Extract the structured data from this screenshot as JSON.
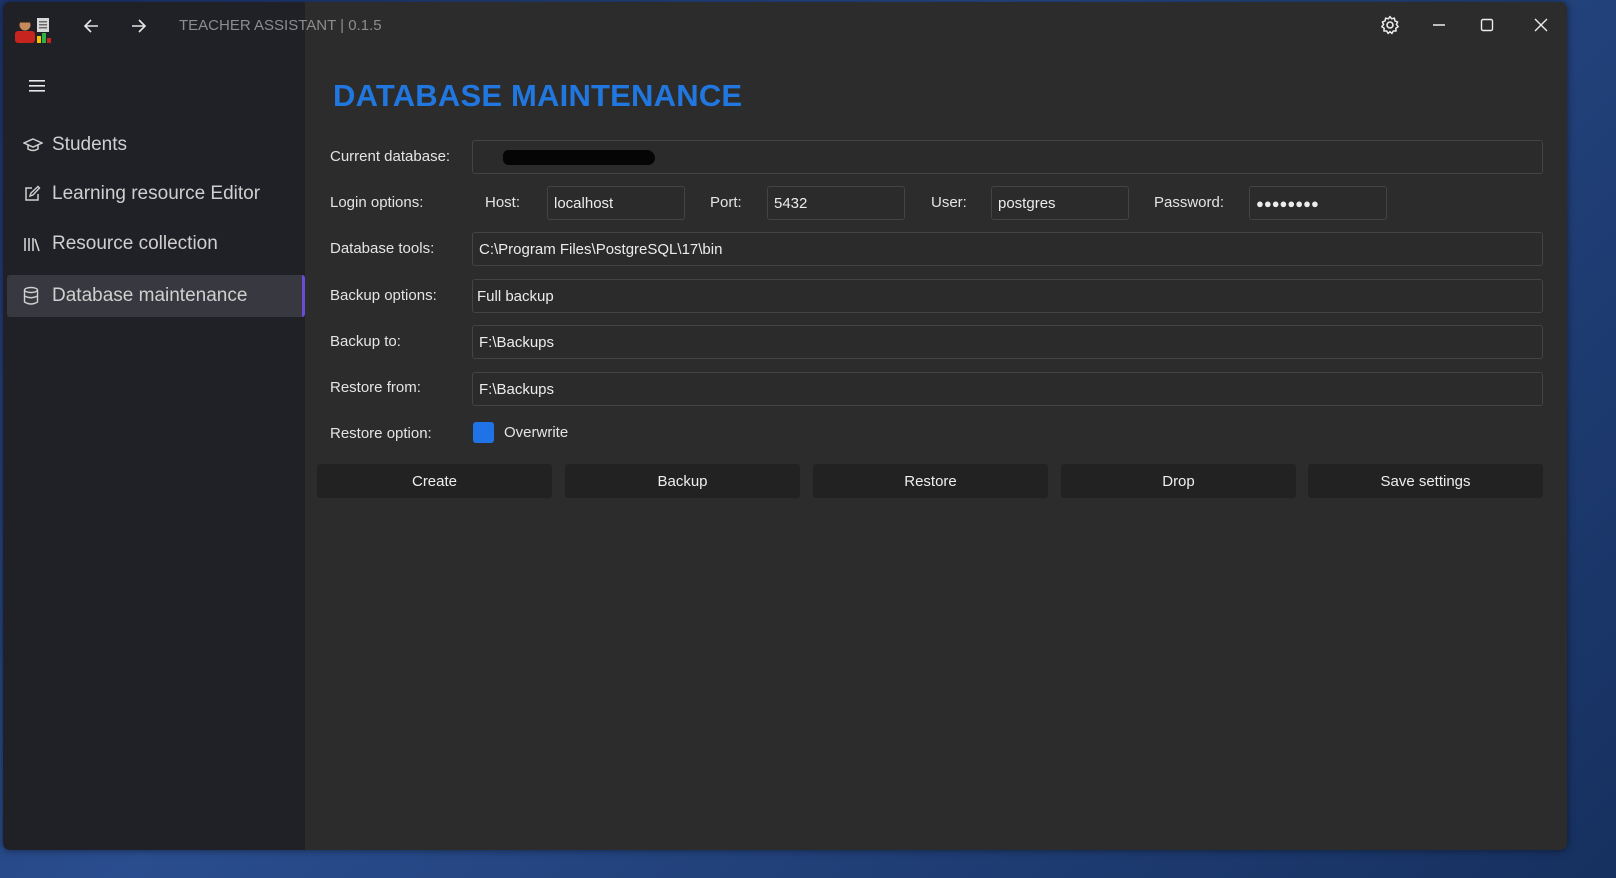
{
  "app": {
    "title": "TEACHER ASSISTANT | 0.1.5",
    "logo_icon": "teacher-app-logo",
    "accent_color": "#2177e0"
  },
  "sidebar": {
    "items": [
      {
        "label": "Students",
        "icon": "graduation-cap-icon"
      },
      {
        "label": "Learning resource Editor",
        "icon": "edit-icon"
      },
      {
        "label": "Resource collection",
        "icon": "library-icon"
      },
      {
        "label": "Database maintenance",
        "icon": "database-icon",
        "active": true
      }
    ]
  },
  "main": {
    "title": "DATABASE MAINTENANCE",
    "current_database": {
      "label": "Current database:",
      "value": ""
    },
    "login": {
      "label": "Login options:",
      "host_label": "Host:",
      "host_value": "localhost",
      "port_label": "Port:",
      "port_value": "5432",
      "user_label": "User:",
      "user_value": "postgres",
      "password_label": "Password:",
      "password_value": "●●●●●●●●"
    },
    "tools": {
      "label": "Database tools:",
      "value": "C:\\Program Files\\PostgreSQL\\17\\bin"
    },
    "backup_options": {
      "label": "Backup options:",
      "value": "Full backup"
    },
    "backup_to": {
      "label": "Backup to:",
      "value": "F:\\Backups"
    },
    "restore_from": {
      "label": "Restore from:",
      "value": "F:\\Backups"
    },
    "restore_option": {
      "label": "Restore option:",
      "checkbox_label": "Overwrite",
      "checked": true
    },
    "buttons": {
      "create": "Create",
      "backup": "Backup",
      "restore": "Restore",
      "drop": "Drop",
      "save": "Save settings"
    }
  }
}
